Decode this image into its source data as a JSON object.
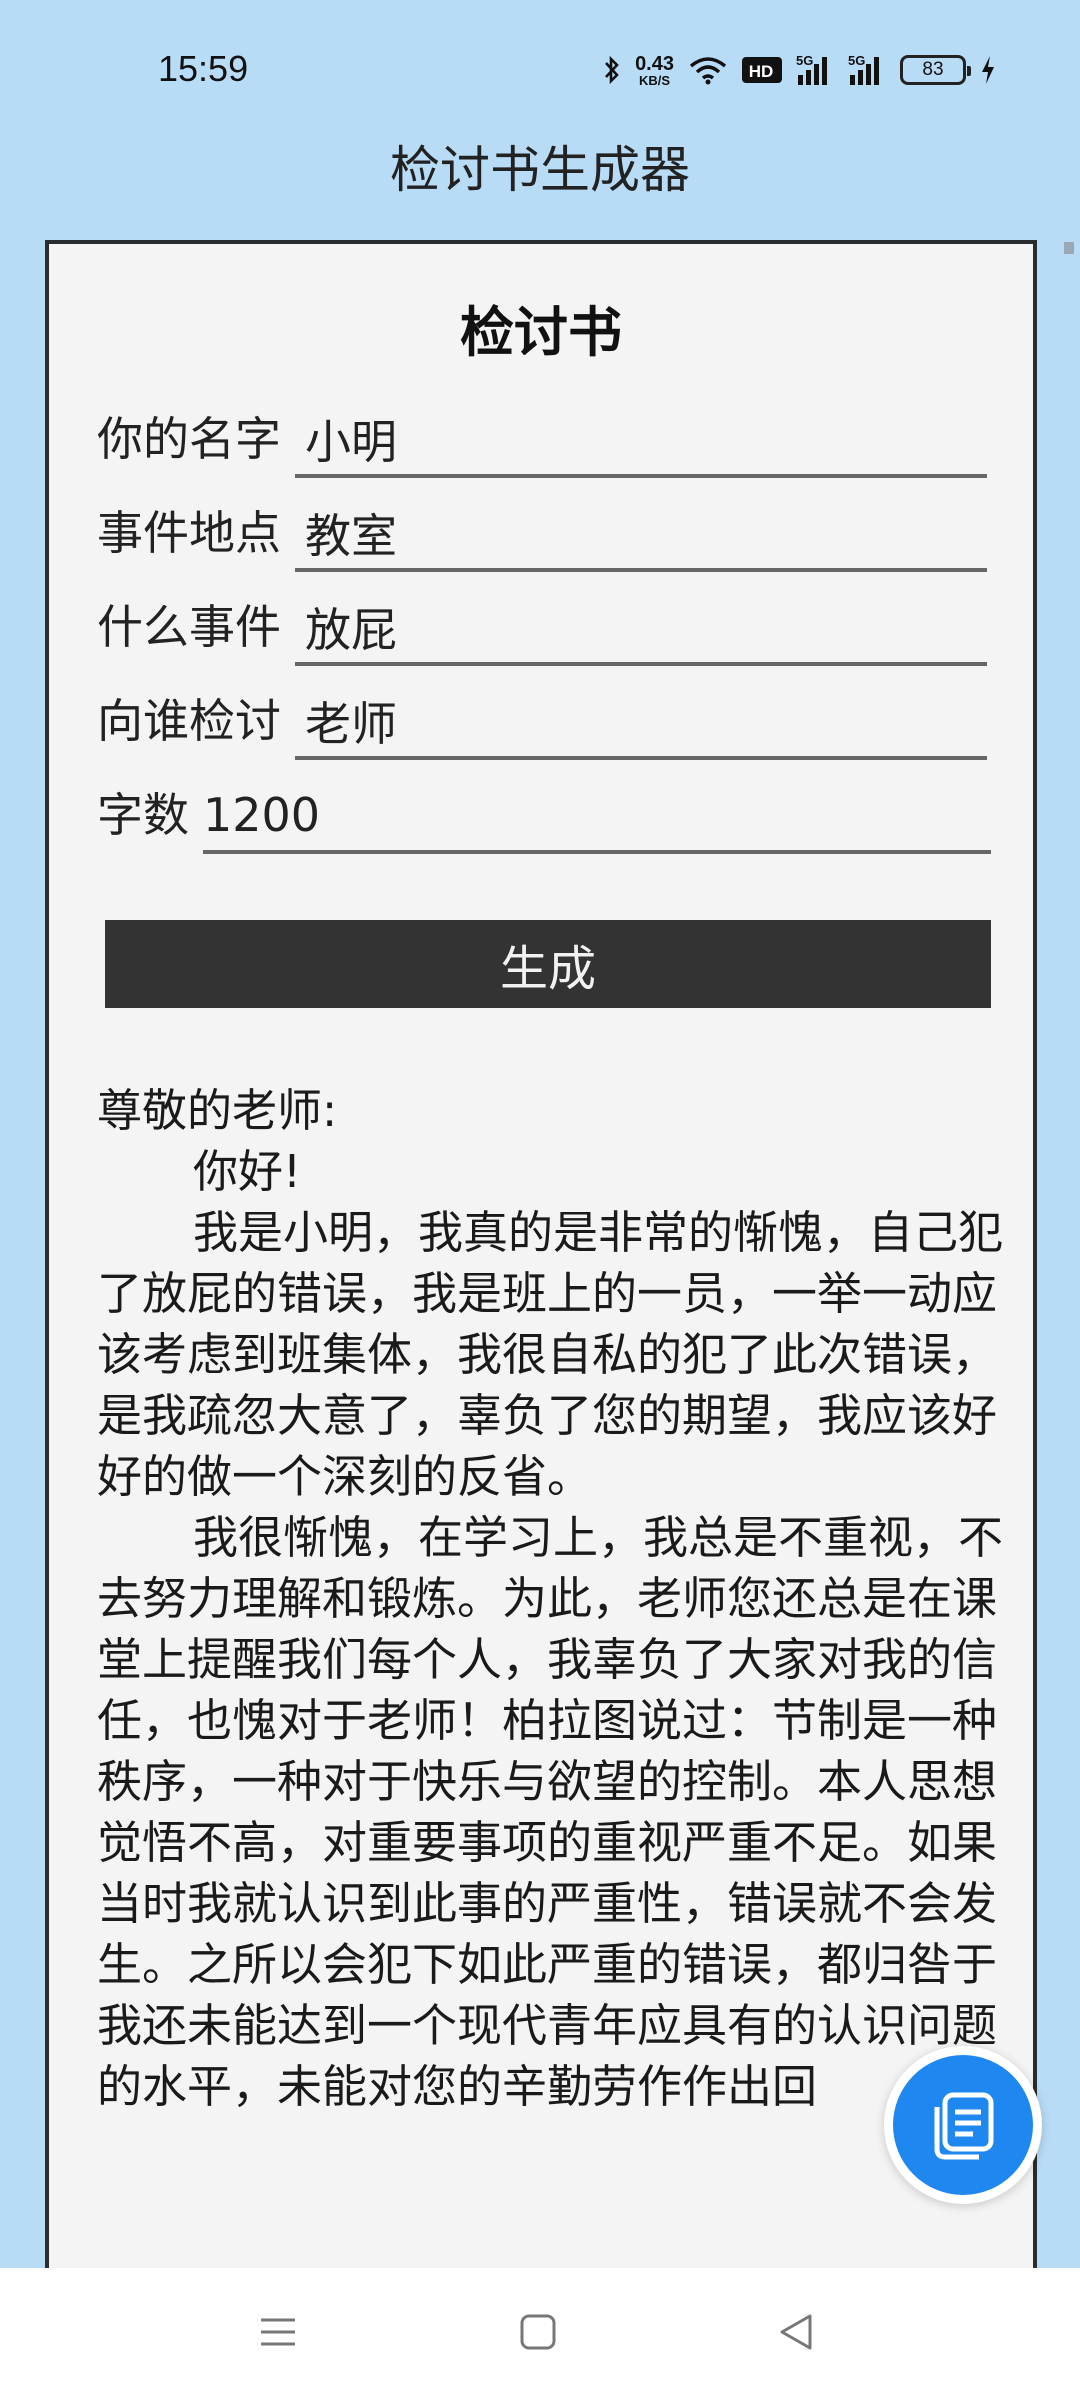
{
  "status_bar": {
    "time": "15:59",
    "net_speed_value": "0.43",
    "net_speed_unit": "KB/S",
    "network_type_1": "5G",
    "network_type_2": "5G",
    "hd_badge": "HD",
    "battery_level": "83"
  },
  "app": {
    "title": "检讨书生成器"
  },
  "form": {
    "title": "检讨书",
    "name_label": "你的名字",
    "name_value": "小明",
    "location_label": "事件地点",
    "location_value": "教室",
    "event_label": "什么事件",
    "event_value": "放屁",
    "recipient_label": "向谁检讨",
    "recipient_value": "老师",
    "word_count_label": "字数",
    "word_count_value": "1200",
    "generate_label": "生成"
  },
  "letter": {
    "salutation": "尊敬的老师:",
    "greeting": "你好!",
    "paragraph1": "我是小明，我真的是非常的惭愧，自己犯了放屁的错误，我是班上的一员，一举一动应该考虑到班集体，我很自私的犯了此次错误，是我疏忽大意了，辜负了您的期望，我应该好好的做一个深刻的反省。",
    "paragraph2": "我很惭愧，在学习上，我总是不重视，不去努力理解和锻炼。为此，老师您还总是在课堂上提醒我们每个人，我辜负了大家对我的信任，也愧对于老师！柏拉图说过：节制是一种秩序，一种对于快乐与欲望的控制。本人思想觉悟不高，对重要事项的重视严重不足。如果当时我就认识到此事的严重性，错误就不会发生。之所以会犯下如此严重的错误，都归咎于我还未能达到一个现代青年应具有的认识问题的水平，未能对您的辛勤劳作作出回"
  },
  "colors": {
    "background": "#b9dcf6",
    "card": "#f4f4f4",
    "button": "#333333",
    "fab": "#1e88f0"
  },
  "icons": {
    "fab": "copy-document-icon",
    "nav_menu": "menu-icon",
    "nav_home": "home-icon",
    "nav_back": "back-icon"
  }
}
